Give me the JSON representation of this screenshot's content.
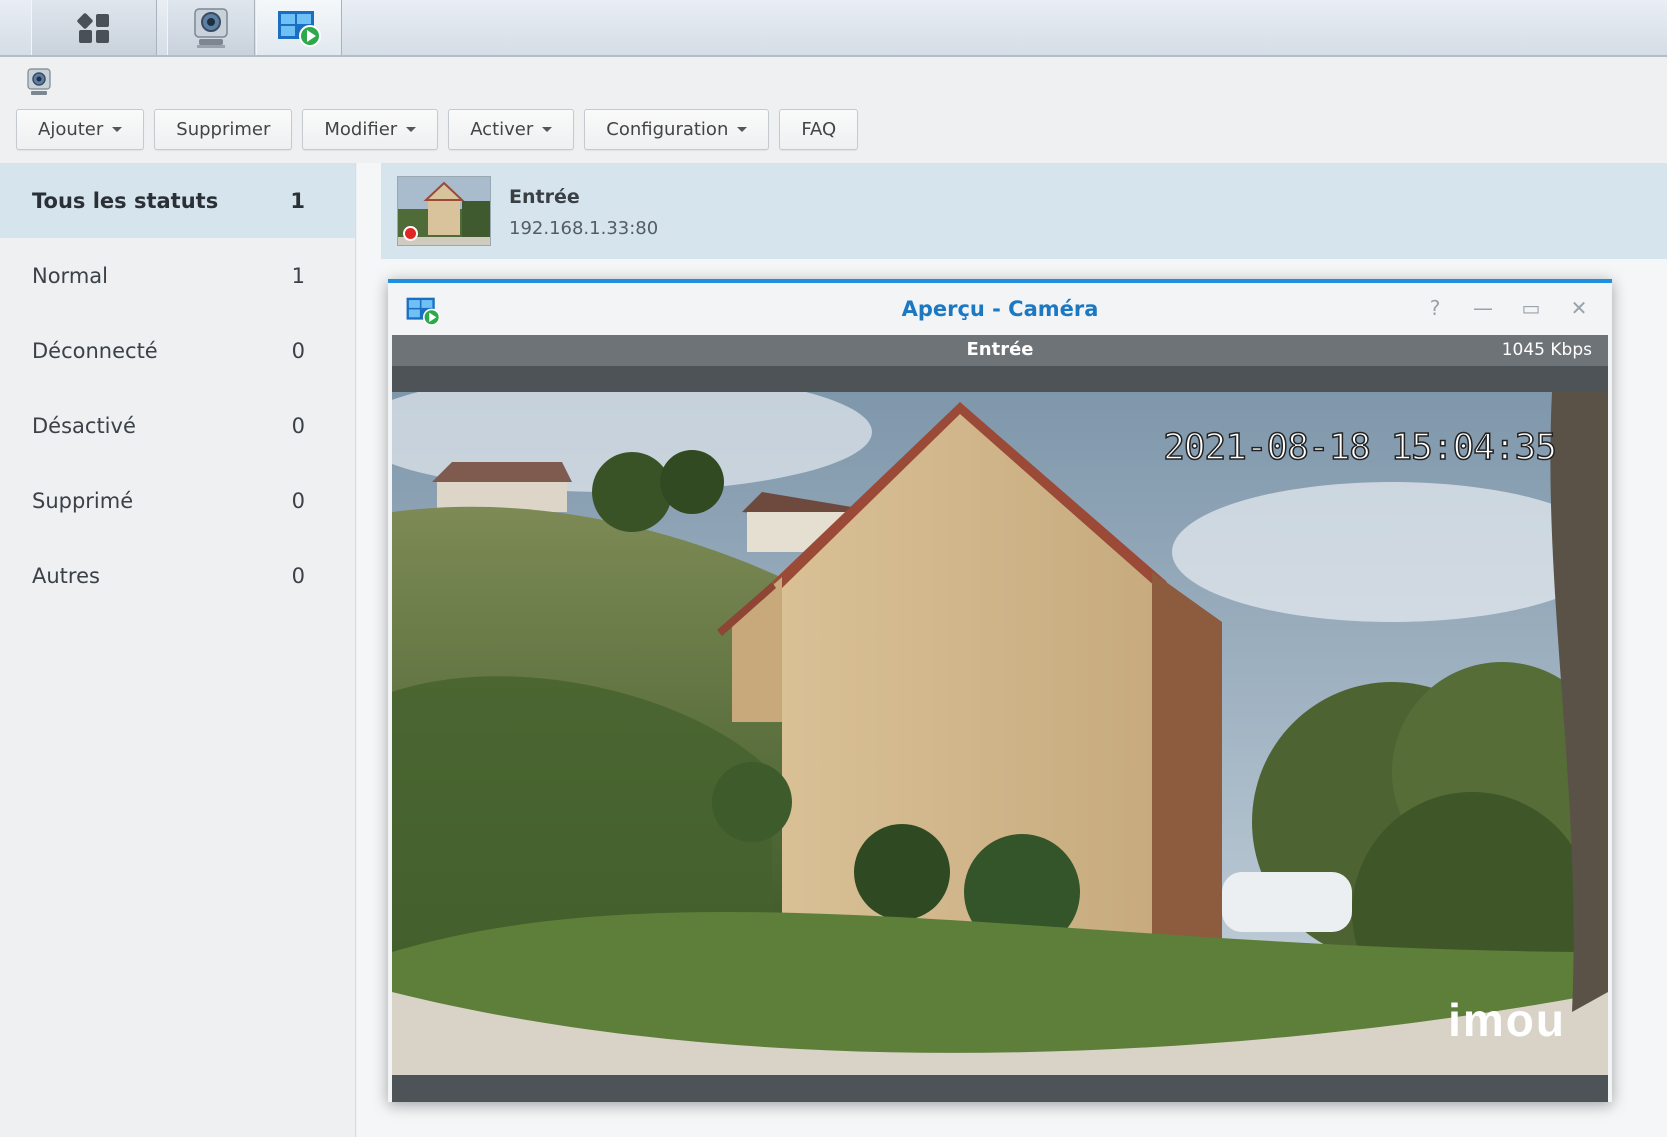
{
  "taskbar": {
    "tiles": [
      {
        "name": "main-menu",
        "icon": "grid-icon"
      },
      {
        "name": "surveillance-station",
        "icon": "camera-app-icon"
      },
      {
        "name": "live-view",
        "icon": "live-view-icon"
      }
    ]
  },
  "app": {
    "icon": "camera-app-icon"
  },
  "toolbar": {
    "add_label": "Ajouter",
    "delete_label": "Supprimer",
    "edit_label": "Modifier",
    "enable_label": "Activer",
    "config_label": "Configuration",
    "faq_label": "FAQ"
  },
  "sidebar": {
    "items": [
      {
        "label": "Tous les statuts",
        "count": "1"
      },
      {
        "label": "Normal",
        "count": "1"
      },
      {
        "label": "Déconnecté",
        "count": "0"
      },
      {
        "label": "Désactivé",
        "count": "0"
      },
      {
        "label": "Supprimé",
        "count": "0"
      },
      {
        "label": "Autres",
        "count": "0"
      }
    ]
  },
  "camera_list": {
    "items": [
      {
        "name": "Entrée",
        "address": "192.168.1.33:80",
        "status": "recording"
      }
    ]
  },
  "preview": {
    "title": "Aperçu - Caméra",
    "camera_name": "Entrée",
    "bitrate": "1045 Kbps",
    "controls": {
      "help": "?",
      "minimize": "—",
      "maximize": "▭",
      "close": "✕"
    },
    "osd_timestamp": "2021-08-18 15:04:35",
    "osd_brand": "imou"
  },
  "colors": {
    "accent": "#1f8fe0",
    "title_blue": "#1d78c2",
    "selected_bg": "#d6e5ed",
    "record_red": "#e02727"
  }
}
